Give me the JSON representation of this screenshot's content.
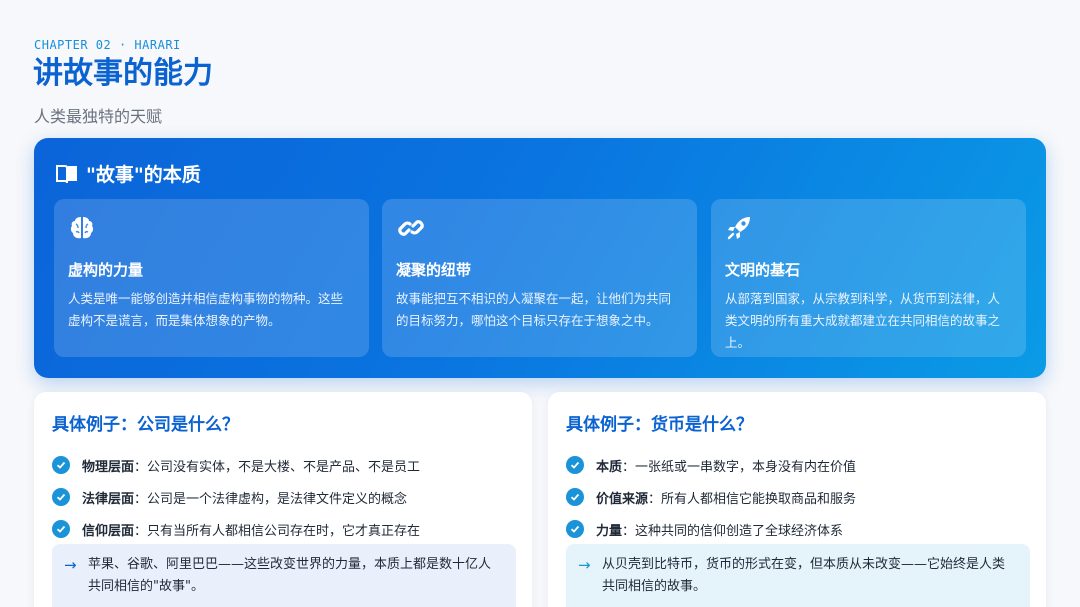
{
  "header": {
    "chapter": "CHAPTER 02 · HARARI",
    "title": "讲故事的能力",
    "subtitle": "人类最独特的天赋"
  },
  "hero": {
    "heading": "\"故事\"的本质",
    "heading_icon": "book-open-icon",
    "cards": [
      {
        "icon": "brain-icon",
        "title": "虚构的力量",
        "text": "人类是唯一能够创造并相信虚构事物的物种。这些虚构不是谎言，而是集体想象的产物。"
      },
      {
        "icon": "link-icon",
        "title": "凝聚的纽带",
        "text": "故事能把互不相识的人凝聚在一起，让他们为共同的目标努力，哪怕这个目标只存在于想象之中。"
      },
      {
        "icon": "rocket-icon",
        "title": "文明的基石",
        "text": "从部落到国家，从宗教到科学，从货币到法律，人类文明的所有重大成就都建立在共同相信的故事之上。"
      }
    ]
  },
  "examples": [
    {
      "title": "具体例子：公司是什么？",
      "items": [
        {
          "label": "物理层面",
          "text": "：公司没有实体，不是大楼、不是产品、不是员工"
        },
        {
          "label": "法律层面",
          "text": "：公司是一个法律虚构，是法律文件定义的概念"
        },
        {
          "label": "信仰层面",
          "text": "：只有当所有人都相信公司存在时，它才真正存在"
        }
      ],
      "note": "苹果、谷歌、阿里巴巴——这些改变世界的力量，本质上都是数十亿人共同相信的\"故事\"。"
    },
    {
      "title": "具体例子：货币是什么？",
      "items": [
        {
          "label": "本质",
          "text": "：一张纸或一串数字，本身没有内在价值"
        },
        {
          "label": "价值来源",
          "text": "：所有人都相信它能换取商品和服务"
        },
        {
          "label": "力量",
          "text": "：这种共同的信仰创造了全球经济体系"
        }
      ],
      "note": "从贝壳到比特币，货币的形式在变，但本质从未改变——它始终是人类共同相信的故事。"
    }
  ],
  "colors": {
    "accent": "#0b63d1",
    "check": "#1a93d9"
  }
}
